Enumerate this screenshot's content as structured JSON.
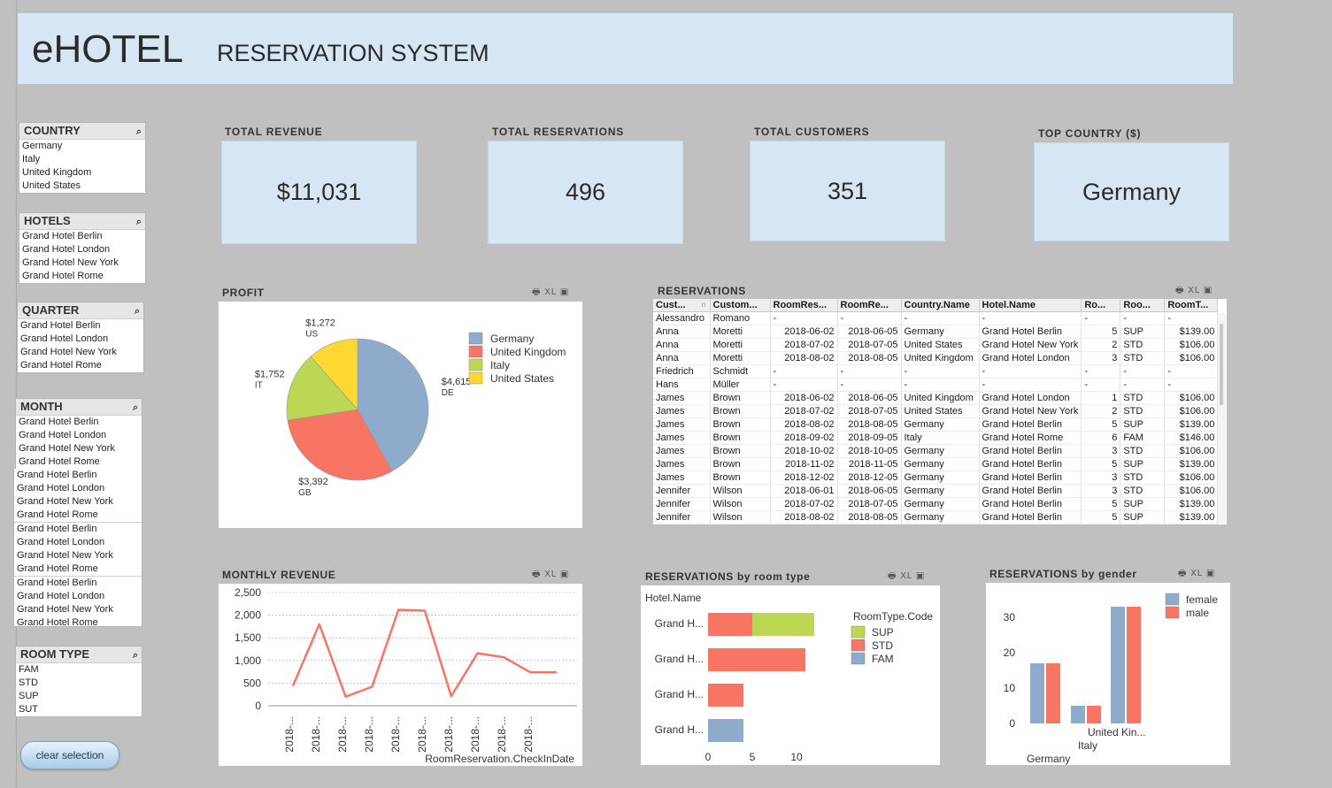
{
  "header": {
    "title": "eHOTEL",
    "subtitle": "RESERVATION SYSTEM"
  },
  "filters": {
    "country": {
      "label": "COUNTRY",
      "items": [
        "Germany",
        "Italy",
        "United Kingdom",
        "United States"
      ]
    },
    "hotels": {
      "label": "HOTELS",
      "items": [
        "Grand Hotel Berlin",
        "Grand Hotel London",
        "Grand Hotel New York",
        "Grand Hotel Rome"
      ]
    },
    "quarter": {
      "label": "QUARTER",
      "items": [
        "Grand Hotel Berlin",
        "Grand Hotel London",
        "Grand Hotel New York",
        "Grand Hotel Rome"
      ]
    },
    "month": {
      "label": "MONTH",
      "items": [
        "Grand Hotel Berlin",
        "Grand Hotel London",
        "Grand Hotel New York",
        "Grand Hotel Rome"
      ],
      "overflow": [
        [
          "Grand Hotel Berlin",
          "Grand Hotel London",
          "Grand Hotel New York",
          "Grand Hotel Rome"
        ],
        [
          "Grand Hotel Berlin",
          "Grand Hotel London",
          "Grand Hotel New York",
          "Grand Hotel Rome"
        ],
        [
          "Grand Hotel Berlin",
          "Grand Hotel London",
          "Grand Hotel New York",
          "Grand Hotel Rome"
        ]
      ]
    },
    "room_type": {
      "label": "ROOM TYPE",
      "items": [
        "FAM",
        "STD",
        "SUP",
        "SUT"
      ]
    },
    "search_icon": "magnifier-icon"
  },
  "clear_button": "clear selection",
  "kpis": [
    {
      "label": "TOTAL  REVENUE",
      "value": "$11,031"
    },
    {
      "label": "TOTAL  RESERVATIONS",
      "value": "496"
    },
    {
      "label": "TOTAL  CUSTOMERS",
      "value": "351"
    },
    {
      "label": "TOP COUNTRY ($)",
      "value": "Germany"
    }
  ],
  "toolbar_labels": {
    "xl": "XL"
  },
  "profit": {
    "title": "PROFIT",
    "chart_data": {
      "type": "pie",
      "slices": [
        {
          "name": "Germany",
          "value": 4615,
          "label": "$4,615",
          "code": "DE",
          "color": "#8eabcb"
        },
        {
          "name": "United Kingdom",
          "value": 3392,
          "label": "$3,392",
          "code": "GB",
          "color": "#f87463"
        },
        {
          "name": "Italy",
          "value": 1752,
          "label": "$1,752",
          "code": "IT",
          "color": "#bcd754"
        },
        {
          "name": "United States",
          "value": 1272,
          "label": "$1,272",
          "code": "US",
          "color": "#fdd832"
        }
      ],
      "legend": "top-right"
    }
  },
  "reservations": {
    "title": "RESERVATIONS",
    "columns": [
      "Cust...",
      "Custom...",
      "RoomRes...",
      "RoomRe...",
      "Country.Name",
      "Hotel.Name",
      "Ro...",
      "Roo...",
      "RoomT..."
    ],
    "sort_indicator": "∩",
    "rows": [
      [
        "Alessandro",
        "Romano",
        "-",
        "-",
        "-",
        "-",
        "-",
        "-",
        "-"
      ],
      [
        "Anna",
        "Moretti",
        "2018-06-02",
        "2018-06-05",
        "Germany",
        "Grand Hotel Berlin",
        "5",
        "SUP",
        "$139.00"
      ],
      [
        "Anna",
        "Moretti",
        "2018-07-02",
        "2018-07-05",
        "United States",
        "Grand Hotel New York",
        "2",
        "STD",
        "$106.00"
      ],
      [
        "Anna",
        "Moretti",
        "2018-08-02",
        "2018-08-05",
        "United Kingdom",
        "Grand Hotel London",
        "3",
        "STD",
        "$106.00"
      ],
      [
        "Friedrich",
        "Schmidt",
        "-",
        "-",
        "-",
        "-",
        "-",
        "-",
        "-"
      ],
      [
        "Hans",
        "Müller",
        "-",
        "-",
        "-",
        "-",
        "-",
        "-",
        "-"
      ],
      [
        "James",
        "Brown",
        "2018-06-02",
        "2018-06-05",
        "United Kingdom",
        "Grand Hotel London",
        "1",
        "STD",
        "$106.00"
      ],
      [
        "James",
        "Brown",
        "2018-07-02",
        "2018-07-05",
        "United States",
        "Grand Hotel New York",
        "2",
        "STD",
        "$106.00"
      ],
      [
        "James",
        "Brown",
        "2018-08-02",
        "2018-08-05",
        "Germany",
        "Grand Hotel Berlin",
        "5",
        "SUP",
        "$139.00"
      ],
      [
        "James",
        "Brown",
        "2018-09-02",
        "2018-09-05",
        "Italy",
        "Grand Hotel Rome",
        "6",
        "FAM",
        "$146.00"
      ],
      [
        "James",
        "Brown",
        "2018-10-02",
        "2018-10-05",
        "Germany",
        "Grand Hotel Berlin",
        "3",
        "STD",
        "$106.00"
      ],
      [
        "James",
        "Brown",
        "2018-11-02",
        "2018-11-05",
        "Germany",
        "Grand Hotel Berlin",
        "5",
        "SUP",
        "$139.00"
      ],
      [
        "James",
        "Brown",
        "2018-12-02",
        "2018-12-05",
        "Germany",
        "Grand Hotel Berlin",
        "3",
        "STD",
        "$106.00"
      ],
      [
        "Jennifer",
        "Wilson",
        "2018-06-01",
        "2018-06-05",
        "Germany",
        "Grand Hotel Berlin",
        "3",
        "STD",
        "$106.00"
      ],
      [
        "Jennifer",
        "Wilson",
        "2018-07-02",
        "2018-07-05",
        "Germany",
        "Grand Hotel Berlin",
        "5",
        "SUP",
        "$139.00"
      ],
      [
        "Jennifer",
        "Wilson",
        "2018-08-02",
        "2018-08-05",
        "Germany",
        "Grand Hotel Berlin",
        "5",
        "SUP",
        "$139.00"
      ]
    ]
  },
  "monthly_revenue": {
    "title": "MONTHLY  REVENUE",
    "chart_data": {
      "type": "line",
      "xlabel": "RoomReservation.CheckInDate",
      "x": [
        "2018-...",
        "2018-...",
        "2018-...",
        "2018-...",
        "2018-...",
        "2018-...",
        "2018-...",
        "2018-...",
        "2018-...",
        "2018-..."
      ],
      "values": [
        440,
        1800,
        200,
        420,
        2120,
        2100,
        210,
        1160,
        1070,
        740,
        740
      ],
      "yticks": [
        "0",
        "500",
        "1,000",
        "1,500",
        "2,000",
        "2,500"
      ],
      "ylim": [
        0,
        2500
      ],
      "grid": true,
      "color": "#f87463"
    }
  },
  "room_type_chart": {
    "title": "RESERVATIONS by room type",
    "chart_data": {
      "type": "bar",
      "orientation": "horizontal",
      "stacked": true,
      "dimension_label": "Hotel.Name",
      "legend_title": "RoomType.Code",
      "categories": [
        "Grand H...",
        "Grand H...",
        "Grand H...",
        "Grand H..."
      ],
      "series": [
        {
          "name": "SUP",
          "color": "#bcd754",
          "values": [
            7,
            0,
            0,
            0
          ]
        },
        {
          "name": "STD",
          "color": "#f87463",
          "values": [
            5,
            11,
            4,
            0
          ]
        },
        {
          "name": "FAM",
          "color": "#8eabcb",
          "values": [
            0,
            0,
            0,
            4
          ]
        }
      ],
      "series_order": [
        "FAM",
        "STD",
        "SUP"
      ],
      "xticks": [
        "0",
        "5",
        "10"
      ],
      "xlim": [
        0,
        12
      ]
    }
  },
  "gender_chart": {
    "title": "RESERVATIONS by gender",
    "chart_data": {
      "type": "bar",
      "categories": [
        "Germany",
        "Italy",
        "United Kin..."
      ],
      "series": [
        {
          "name": "female",
          "color": "#8eabcb",
          "values": [
            17,
            5,
            33
          ]
        },
        {
          "name": "male",
          "color": "#f87463",
          "values": [
            17,
            5,
            33
          ]
        }
      ],
      "yticks": [
        "0",
        "10",
        "20",
        "30"
      ],
      "ylim": [
        0,
        35
      ]
    }
  }
}
